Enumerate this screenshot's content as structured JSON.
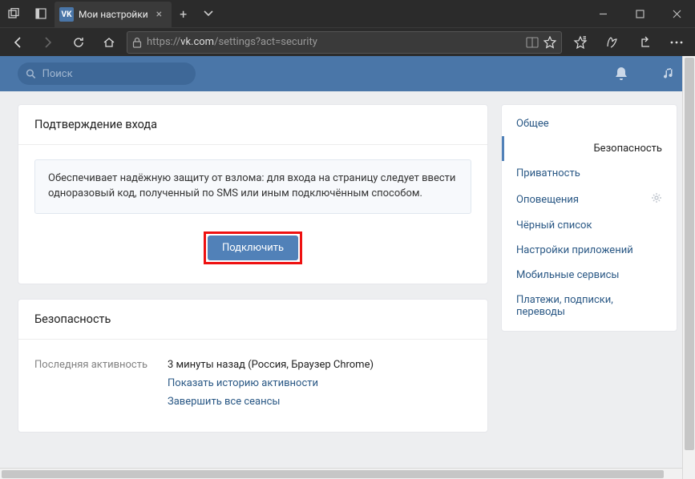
{
  "browser": {
    "tab_favicon": "VK",
    "tab_title": "Мои настройки",
    "url_scheme": "https://",
    "url_host": "vk.com",
    "url_path": "/settings?act=security"
  },
  "vk": {
    "search_placeholder": "Поиск"
  },
  "card1": {
    "title": "Подтверждение входа",
    "info": "Обеспечивает надёжную защиту от взлома: для входа на страницу следует ввести одноразовый код, полученный по SMS или иным подключённым способом.",
    "button": "Подключить"
  },
  "card2": {
    "title": "Безопасность",
    "activity_label": "Последняя активность",
    "activity_value": "3 минуты назад (Россия, Браузер Chrome)",
    "show_history": "Показать историю активности",
    "end_sessions": "Завершить все сеансы"
  },
  "sidebar": {
    "items": [
      {
        "label": "Общее"
      },
      {
        "label": "Безопасность"
      },
      {
        "label": "Приватность"
      },
      {
        "label": "Оповещения"
      },
      {
        "label": "Чёрный список"
      },
      {
        "label": "Настройки приложений"
      },
      {
        "label": "Мобильные сервисы"
      },
      {
        "label": "Платежи, подписки, переводы"
      }
    ]
  }
}
